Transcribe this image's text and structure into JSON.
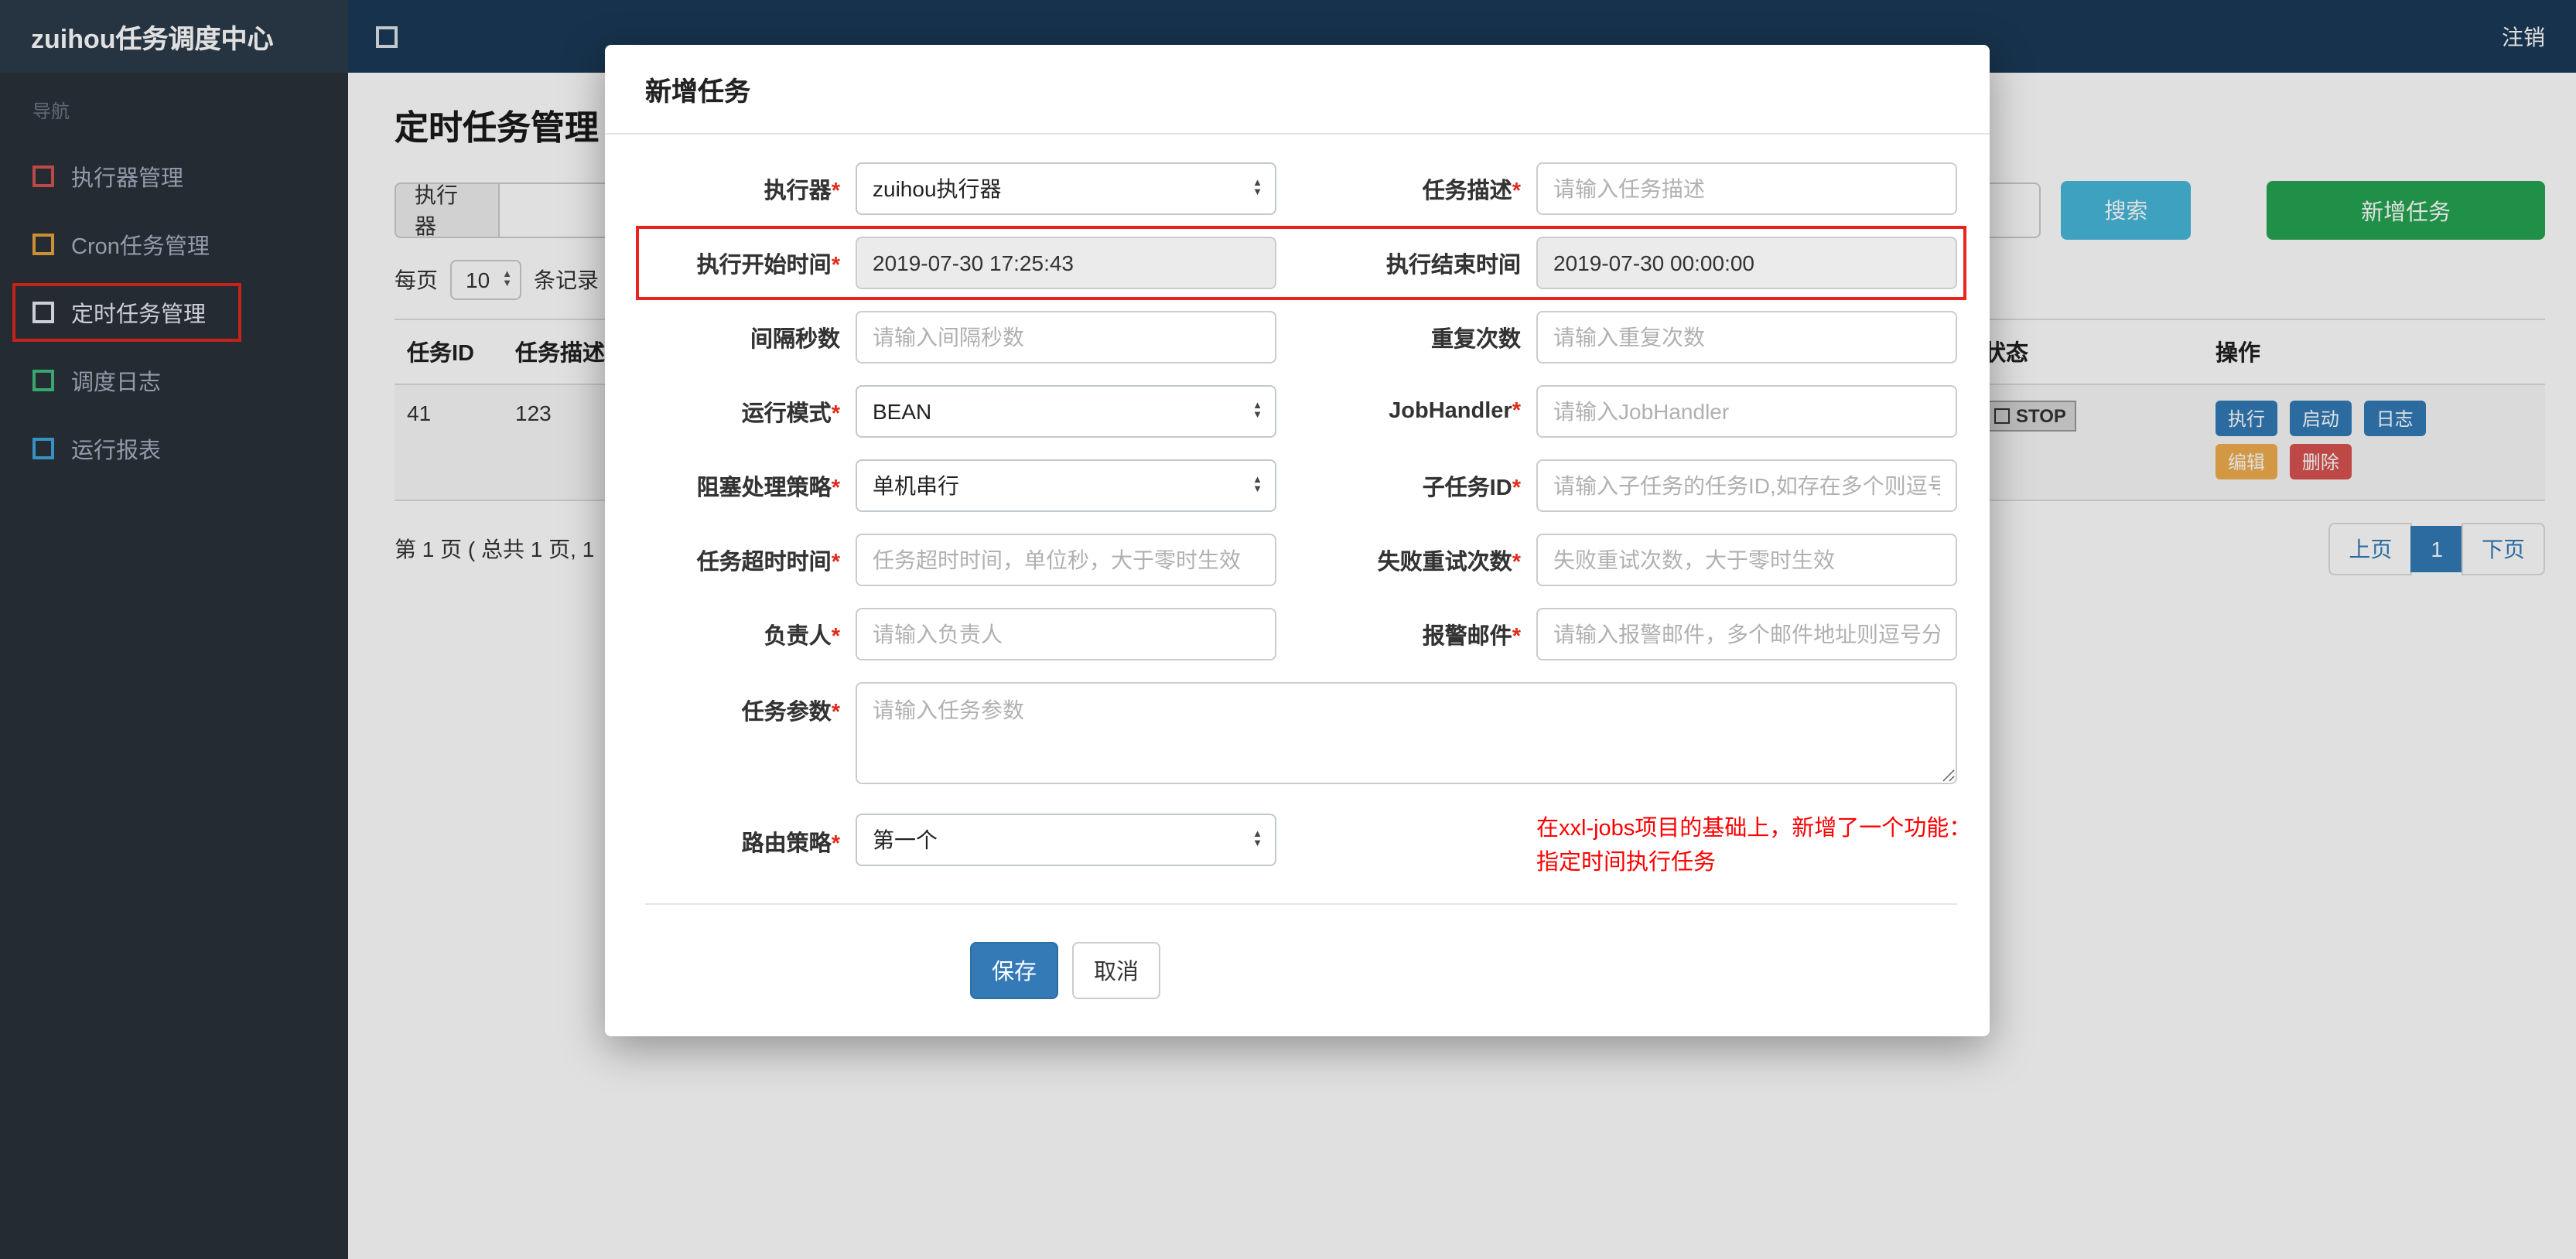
{
  "colors": {
    "navbar_bg": "#1b3a57",
    "brand_bg": "#2c3b4a",
    "sidebar_bg": "#2b323b",
    "accent_blue": "#337ab7",
    "search_teal": "#46b8da",
    "add_green": "#25a452",
    "edit_orange": "#f0ad4e",
    "delete_red": "#d9534f",
    "note_red": "#ff0000",
    "highlight_red": "#e8241d"
  },
  "navbar": {
    "brand": "zuihou任务调度中心",
    "logout": "注销"
  },
  "sidebar": {
    "nav_label": "导航",
    "items": [
      {
        "label": "执行器管理",
        "color": "#d9534f"
      },
      {
        "label": "Cron任务管理",
        "color": "#e8a33d"
      },
      {
        "label": "定时任务管理",
        "color": "#e8edf3",
        "active": true
      },
      {
        "label": "调度日志",
        "color": "#3fbf7f"
      },
      {
        "label": "运行报表",
        "color": "#3fa7dc"
      }
    ]
  },
  "content": {
    "page_title": "定时任务管理",
    "toolbar": {
      "executor_label": "执行器",
      "search": "搜索",
      "add_task": "新增任务"
    },
    "perpage": {
      "prefix": "每页",
      "value": "10",
      "suffix": "条记录"
    },
    "table": {
      "col_id": "任务ID",
      "col_desc": "任务描述",
      "col_status": "状态",
      "col_action": "操作",
      "row": {
        "id": "41",
        "desc": "123",
        "status": "STOP",
        "btn_run": "执行",
        "btn_start": "启动",
        "btn_log": "日志",
        "btn_edit": "编辑",
        "btn_delete": "删除"
      }
    },
    "pagination": {
      "info": "第 1 页 ( 总共 1 页, 1",
      "prev": "上页",
      "current": "1",
      "next": "下页"
    }
  },
  "modal": {
    "title": "新增任务",
    "req": "*",
    "f_executor": {
      "label": "执行器",
      "value": "zuihou执行器"
    },
    "f_desc": {
      "label": "任务描述",
      "placeholder": "请输入任务描述"
    },
    "f_start": {
      "label": "执行开始时间",
      "value": "2019-07-30 17:25:43"
    },
    "f_end": {
      "label": "执行结束时间",
      "value": "2019-07-30 00:00:00"
    },
    "f_interval": {
      "label": "间隔秒数",
      "placeholder": "请输入间隔秒数"
    },
    "f_repeat": {
      "label": "重复次数",
      "placeholder": "请输入重复次数"
    },
    "f_mode": {
      "label": "运行模式",
      "value": "BEAN"
    },
    "f_handler": {
      "label": "JobHandler",
      "placeholder": "请输入JobHandler"
    },
    "f_block": {
      "label": "阻塞处理策略",
      "value": "单机串行"
    },
    "f_child": {
      "label": "子任务ID",
      "placeholder": "请输入子任务的任务ID,如存在多个则逗号分隔"
    },
    "f_timeout": {
      "label": "任务超时时间",
      "placeholder": "任务超时时间，单位秒，大于零时生效"
    },
    "f_retry": {
      "label": "失败重试次数",
      "placeholder": "失败重试次数，大于零时生效"
    },
    "f_owner": {
      "label": "负责人",
      "placeholder": "请输入负责人"
    },
    "f_email": {
      "label": "报警邮件",
      "placeholder": "请输入报警邮件，多个邮件地址则逗号分隔"
    },
    "f_param": {
      "label": "任务参数",
      "placeholder": "请输入任务参数"
    },
    "f_route": {
      "label": "路由策略",
      "value": "第一个"
    },
    "note_line1": "在xxl-jobs项目的基础上，新增了一个功能：",
    "note_line2": "指定时间执行任务",
    "save": "保存",
    "cancel": "取消"
  }
}
